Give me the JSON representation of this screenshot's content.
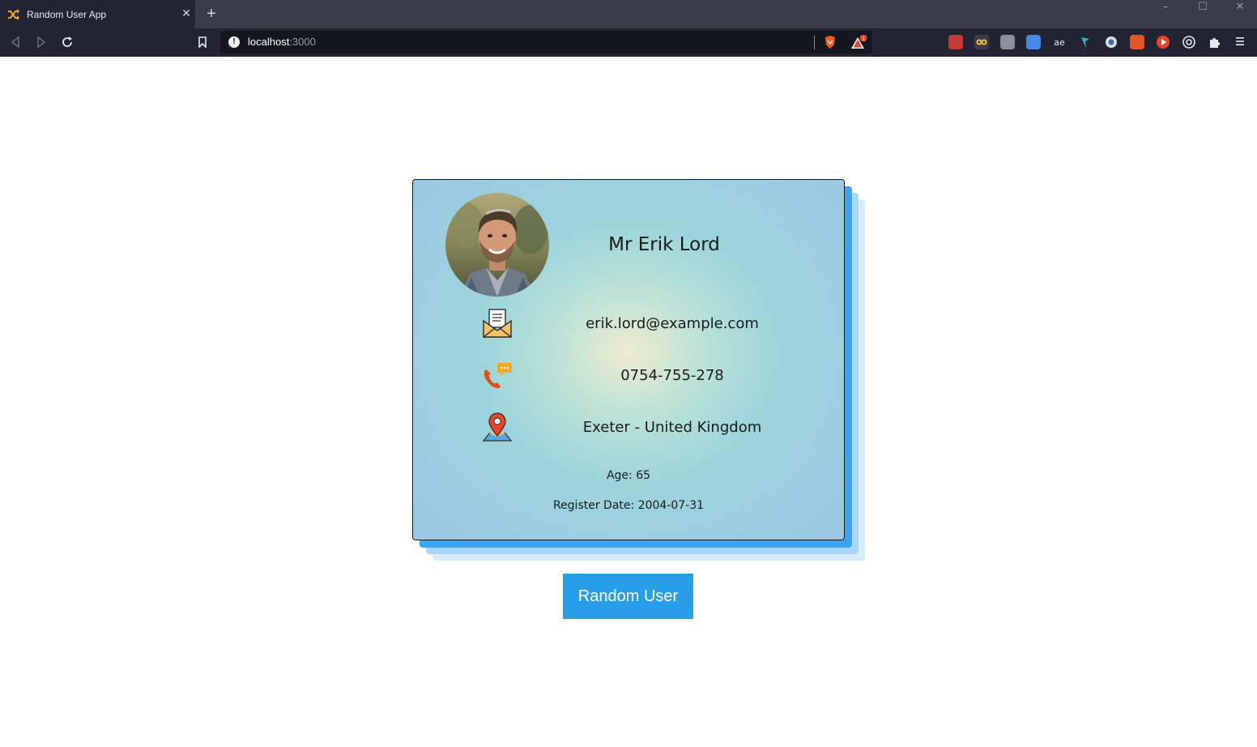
{
  "browser": {
    "tab_title": "Random User App",
    "tab_close": "✕",
    "new_tab": "+",
    "url_host": "localhost",
    "url_port": ":3000",
    "rewards_badge": "1",
    "window_controls": {
      "minimize": "–",
      "maximize": "☐",
      "close": "✕"
    },
    "extensions": [
      "ext-red-icon",
      "ext-owl-icon",
      "ext-gray-icon",
      "ext-translate-icon",
      "ext-ae-icon",
      "ext-bird-icon",
      "ext-circle-icon",
      "ext-orange-icon",
      "ext-play-icon",
      "ext-target-icon"
    ]
  },
  "user": {
    "name": "Mr Erik Lord",
    "email": "erik.lord@example.com",
    "phone": "0754-755-278",
    "location": "Exeter - United Kingdom",
    "age": "Age: 65",
    "register_date": "Register Date: 2004-07-31"
  },
  "actions": {
    "random_user_label": "Random User"
  },
  "colors": {
    "button": "#2a9fe9",
    "card_shadow": "#3ba3f5"
  }
}
